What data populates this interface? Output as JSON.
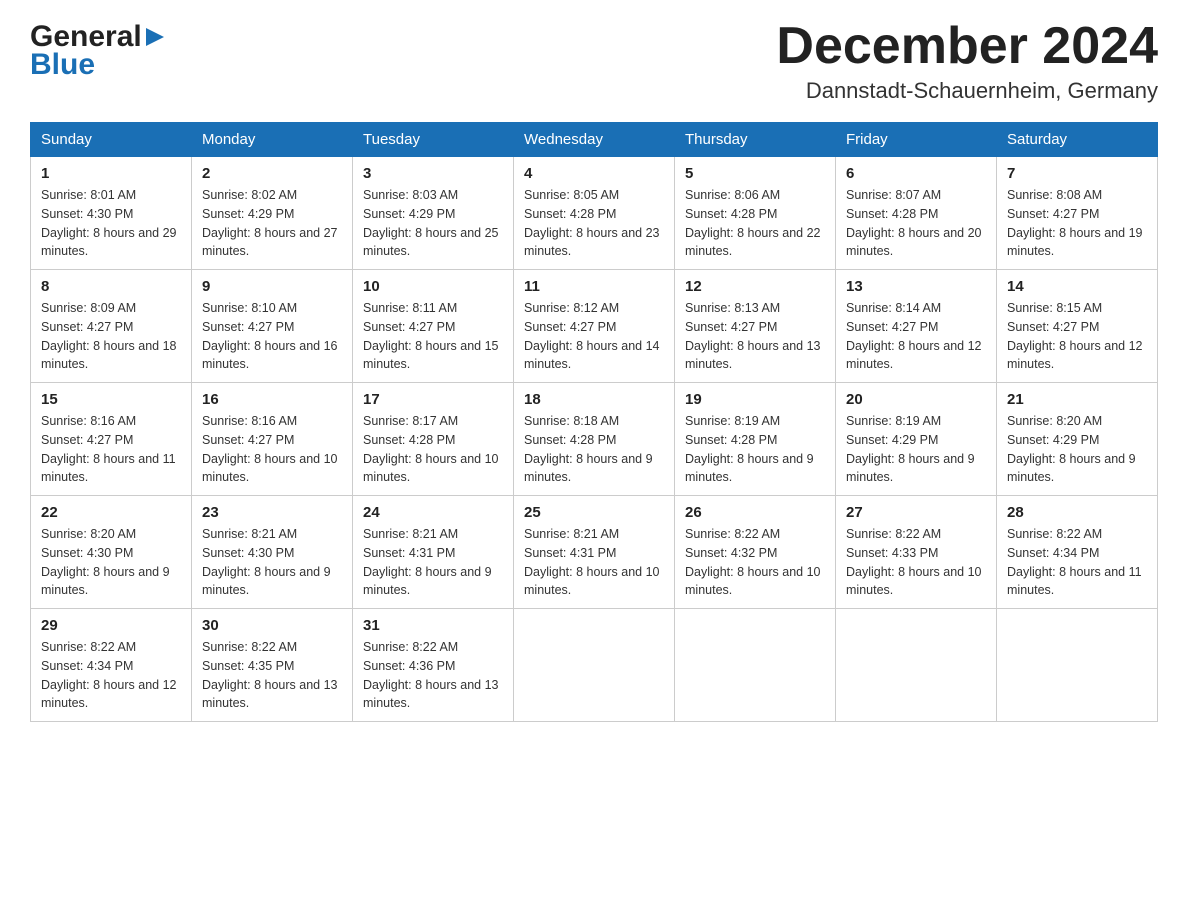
{
  "header": {
    "logo_general": "General",
    "logo_blue": "Blue",
    "month_title": "December 2024",
    "location": "Dannstadt-Schauernheim, Germany"
  },
  "weekdays": [
    "Sunday",
    "Monday",
    "Tuesday",
    "Wednesday",
    "Thursday",
    "Friday",
    "Saturday"
  ],
  "weeks": [
    [
      {
        "day": "1",
        "sunrise": "8:01 AM",
        "sunset": "4:30 PM",
        "daylight": "8 hours and 29 minutes."
      },
      {
        "day": "2",
        "sunrise": "8:02 AM",
        "sunset": "4:29 PM",
        "daylight": "8 hours and 27 minutes."
      },
      {
        "day": "3",
        "sunrise": "8:03 AM",
        "sunset": "4:29 PM",
        "daylight": "8 hours and 25 minutes."
      },
      {
        "day": "4",
        "sunrise": "8:05 AM",
        "sunset": "4:28 PM",
        "daylight": "8 hours and 23 minutes."
      },
      {
        "day": "5",
        "sunrise": "8:06 AM",
        "sunset": "4:28 PM",
        "daylight": "8 hours and 22 minutes."
      },
      {
        "day": "6",
        "sunrise": "8:07 AM",
        "sunset": "4:28 PM",
        "daylight": "8 hours and 20 minutes."
      },
      {
        "day": "7",
        "sunrise": "8:08 AM",
        "sunset": "4:27 PM",
        "daylight": "8 hours and 19 minutes."
      }
    ],
    [
      {
        "day": "8",
        "sunrise": "8:09 AM",
        "sunset": "4:27 PM",
        "daylight": "8 hours and 18 minutes."
      },
      {
        "day": "9",
        "sunrise": "8:10 AM",
        "sunset": "4:27 PM",
        "daylight": "8 hours and 16 minutes."
      },
      {
        "day": "10",
        "sunrise": "8:11 AM",
        "sunset": "4:27 PM",
        "daylight": "8 hours and 15 minutes."
      },
      {
        "day": "11",
        "sunrise": "8:12 AM",
        "sunset": "4:27 PM",
        "daylight": "8 hours and 14 minutes."
      },
      {
        "day": "12",
        "sunrise": "8:13 AM",
        "sunset": "4:27 PM",
        "daylight": "8 hours and 13 minutes."
      },
      {
        "day": "13",
        "sunrise": "8:14 AM",
        "sunset": "4:27 PM",
        "daylight": "8 hours and 12 minutes."
      },
      {
        "day": "14",
        "sunrise": "8:15 AM",
        "sunset": "4:27 PM",
        "daylight": "8 hours and 12 minutes."
      }
    ],
    [
      {
        "day": "15",
        "sunrise": "8:16 AM",
        "sunset": "4:27 PM",
        "daylight": "8 hours and 11 minutes."
      },
      {
        "day": "16",
        "sunrise": "8:16 AM",
        "sunset": "4:27 PM",
        "daylight": "8 hours and 10 minutes."
      },
      {
        "day": "17",
        "sunrise": "8:17 AM",
        "sunset": "4:28 PM",
        "daylight": "8 hours and 10 minutes."
      },
      {
        "day": "18",
        "sunrise": "8:18 AM",
        "sunset": "4:28 PM",
        "daylight": "8 hours and 9 minutes."
      },
      {
        "day": "19",
        "sunrise": "8:19 AM",
        "sunset": "4:28 PM",
        "daylight": "8 hours and 9 minutes."
      },
      {
        "day": "20",
        "sunrise": "8:19 AM",
        "sunset": "4:29 PM",
        "daylight": "8 hours and 9 minutes."
      },
      {
        "day": "21",
        "sunrise": "8:20 AM",
        "sunset": "4:29 PM",
        "daylight": "8 hours and 9 minutes."
      }
    ],
    [
      {
        "day": "22",
        "sunrise": "8:20 AM",
        "sunset": "4:30 PM",
        "daylight": "8 hours and 9 minutes."
      },
      {
        "day": "23",
        "sunrise": "8:21 AM",
        "sunset": "4:30 PM",
        "daylight": "8 hours and 9 minutes."
      },
      {
        "day": "24",
        "sunrise": "8:21 AM",
        "sunset": "4:31 PM",
        "daylight": "8 hours and 9 minutes."
      },
      {
        "day": "25",
        "sunrise": "8:21 AM",
        "sunset": "4:31 PM",
        "daylight": "8 hours and 10 minutes."
      },
      {
        "day": "26",
        "sunrise": "8:22 AM",
        "sunset": "4:32 PM",
        "daylight": "8 hours and 10 minutes."
      },
      {
        "day": "27",
        "sunrise": "8:22 AM",
        "sunset": "4:33 PM",
        "daylight": "8 hours and 10 minutes."
      },
      {
        "day": "28",
        "sunrise": "8:22 AM",
        "sunset": "4:34 PM",
        "daylight": "8 hours and 11 minutes."
      }
    ],
    [
      {
        "day": "29",
        "sunrise": "8:22 AM",
        "sunset": "4:34 PM",
        "daylight": "8 hours and 12 minutes."
      },
      {
        "day": "30",
        "sunrise": "8:22 AM",
        "sunset": "4:35 PM",
        "daylight": "8 hours and 13 minutes."
      },
      {
        "day": "31",
        "sunrise": "8:22 AM",
        "sunset": "4:36 PM",
        "daylight": "8 hours and 13 minutes."
      },
      null,
      null,
      null,
      null
    ]
  ]
}
